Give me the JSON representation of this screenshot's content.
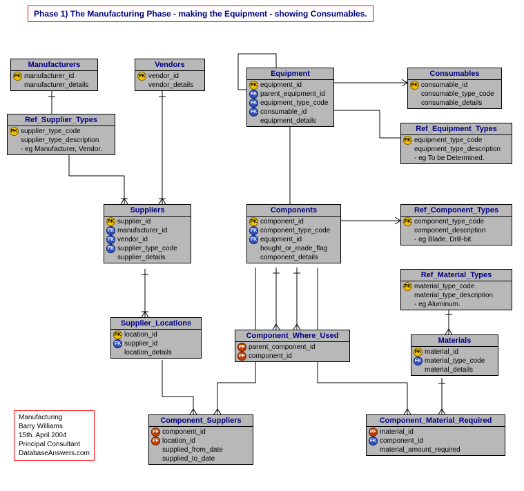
{
  "title": "Phase 1) The Manufacturing Phase - making the Equipment - showing Consumables.",
  "info": {
    "l1": "Manufacturing",
    "l2": "Barry Williams",
    "l3": "15th. April 2004",
    "l4": "Principal Consultant",
    "l5": "DatabaseAnswers.com"
  },
  "entities": {
    "manufacturers": {
      "name": "Manufacturers",
      "rows": [
        {
          "k": "pk",
          "t": "manufacturer_id"
        },
        {
          "k": "",
          "t": "manufacturer_details"
        }
      ]
    },
    "vendors": {
      "name": "Vendors",
      "rows": [
        {
          "k": "pk",
          "t": "vendor_id"
        },
        {
          "k": "",
          "t": "vendor_details"
        }
      ]
    },
    "ref_supplier_types": {
      "name": "Ref_Supplier_Types",
      "rows": [
        {
          "k": "pk",
          "t": "supplier_type_code"
        },
        {
          "k": "",
          "t": "supplier_type_description"
        },
        {
          "k": "",
          "t": "- eg Manufacturer, Vendor."
        }
      ]
    },
    "equipment": {
      "name": "Equipment",
      "rows": [
        {
          "k": "pk",
          "t": "equipment_id"
        },
        {
          "k": "fk",
          "t": "parent_equipment_id"
        },
        {
          "k": "fk",
          "t": "equipment_type_code"
        },
        {
          "k": "fk",
          "t": "consumable_id"
        },
        {
          "k": "",
          "t": "equipment_details"
        }
      ]
    },
    "consumables": {
      "name": "Consumables",
      "rows": [
        {
          "k": "pk",
          "t": "consumable_id"
        },
        {
          "k": "",
          "t": "consumable_type_code"
        },
        {
          "k": "",
          "t": "consumable_details"
        }
      ]
    },
    "ref_equipment_types": {
      "name": "Ref_Equipment_Types",
      "rows": [
        {
          "k": "pk",
          "t": "equipment_type_code"
        },
        {
          "k": "",
          "t": "equipment_type_description"
        },
        {
          "k": "",
          "t": "- eg To be Determined."
        }
      ]
    },
    "suppliers": {
      "name": "Suppliers",
      "rows": [
        {
          "k": "pk",
          "t": "supplier_id"
        },
        {
          "k": "fk",
          "t": "manufacturer_id"
        },
        {
          "k": "fk",
          "t": "vendor_id"
        },
        {
          "k": "fk",
          "t": "supplier_type_code"
        },
        {
          "k": "",
          "t": "supplier_details"
        }
      ]
    },
    "components": {
      "name": "Components",
      "rows": [
        {
          "k": "pk",
          "t": "component_id"
        },
        {
          "k": "fk",
          "t": "component_type_code"
        },
        {
          "k": "fk",
          "t": "equipment_id"
        },
        {
          "k": "",
          "t": "bought_or_made_flag"
        },
        {
          "k": "",
          "t": "component_details"
        }
      ]
    },
    "ref_component_types": {
      "name": "Ref_Component_Types",
      "rows": [
        {
          "k": "pk",
          "t": "component_type_code"
        },
        {
          "k": "",
          "t": "component_description"
        },
        {
          "k": "",
          "t": "- eg Blade, Drill-bit."
        }
      ]
    },
    "ref_material_types": {
      "name": "Ref_Material_Types",
      "rows": [
        {
          "k": "pk",
          "t": "material_type_code"
        },
        {
          "k": "",
          "t": "material_type_description"
        },
        {
          "k": "",
          "t": "- eg Aluminum."
        }
      ]
    },
    "supplier_locations": {
      "name": "Supplier_Locations",
      "rows": [
        {
          "k": "pk",
          "t": "location_id"
        },
        {
          "k": "fk",
          "t": "supplier_id"
        },
        {
          "k": "",
          "t": "location_details"
        }
      ]
    },
    "component_where_used": {
      "name": "Component_Where_Used",
      "rows": [
        {
          "k": "pf",
          "t": "parent_component_id"
        },
        {
          "k": "pf",
          "t": "component_id"
        }
      ]
    },
    "materials": {
      "name": "Materials",
      "rows": [
        {
          "k": "pk",
          "t": "material_id"
        },
        {
          "k": "fk",
          "t": "material_type_code"
        },
        {
          "k": "",
          "t": "material_details"
        }
      ]
    },
    "component_suppliers": {
      "name": "Component_Suppliers",
      "rows": [
        {
          "k": "pf",
          "t": "component_id"
        },
        {
          "k": "pf",
          "t": "location_id"
        },
        {
          "k": "",
          "t": "supplied_from_date"
        },
        {
          "k": "",
          "t": "supplied_to_date"
        }
      ]
    },
    "component_material_required": {
      "name": "Component_Material_Required",
      "rows": [
        {
          "k": "pf",
          "t": "material_id"
        },
        {
          "k": "fk",
          "t": "component_id"
        },
        {
          "k": "",
          "t": "material_amount_required"
        }
      ]
    }
  }
}
